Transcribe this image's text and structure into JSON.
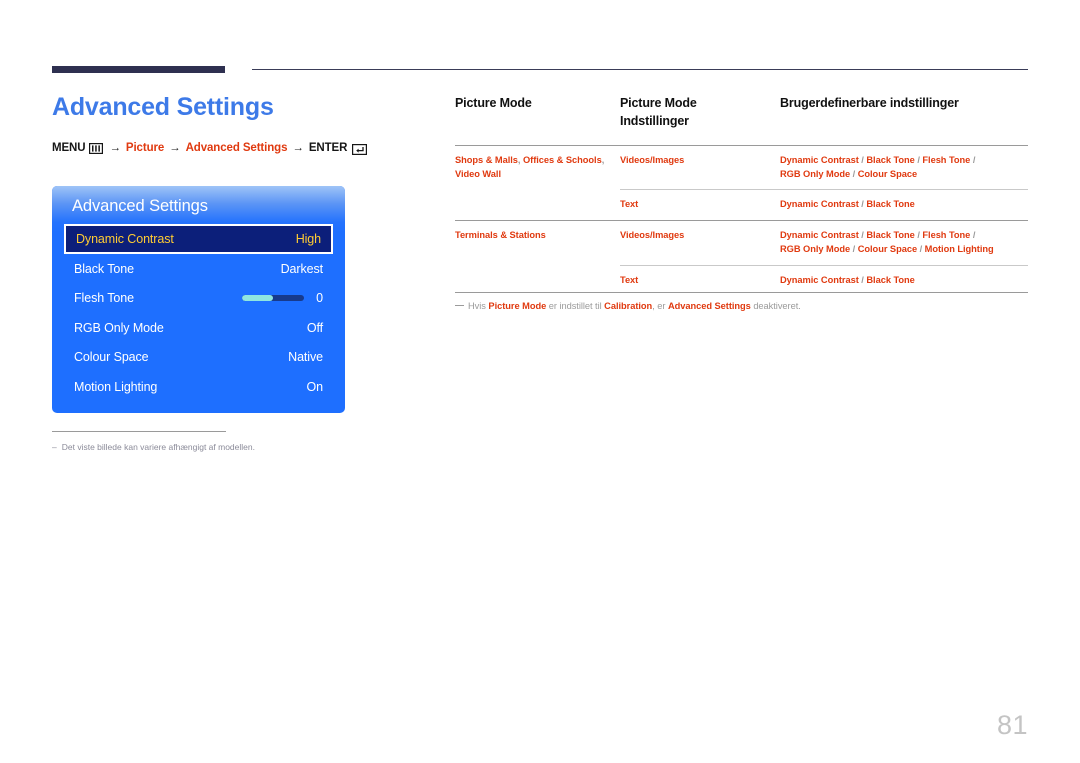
{
  "page": {
    "title": "Advanced Settings",
    "page_number": "81",
    "title_color": "#3d7ae8",
    "accent_red": "#e03a10",
    "rule_color": "#2e3050"
  },
  "menu_path": {
    "menu_label": "MENU",
    "menu_icon": "menu-bars-icon",
    "arrow": "→",
    "step1": "Picture",
    "step2": "Advanced Settings",
    "enter_label": "ENTER",
    "enter_icon": "enter-return-icon"
  },
  "osd": {
    "title": "Advanced Settings",
    "background": "#1e6fff",
    "selected_background": "#0c1f7a",
    "selected_text": "#ffcc33",
    "rows": [
      {
        "label": "Dynamic Contrast",
        "value": "High",
        "selected": true,
        "type": "value"
      },
      {
        "label": "Black Tone",
        "value": "Darkest",
        "selected": false,
        "type": "value"
      },
      {
        "label": "Flesh Tone",
        "value": "0",
        "selected": false,
        "type": "slider",
        "slider_percent": 50
      },
      {
        "label": "RGB Only Mode",
        "value": "Off",
        "selected": false,
        "type": "value"
      },
      {
        "label": "Colour Space",
        "value": "Native",
        "selected": false,
        "type": "value"
      },
      {
        "label": "Motion Lighting",
        "value": "On",
        "selected": false,
        "type": "value"
      }
    ]
  },
  "left_note": {
    "dash": "–",
    "text": "Det viste billede kan variere afhængigt af modellen."
  },
  "table": {
    "headers": {
      "col1": "Picture Mode",
      "col2_line1": "Picture Mode",
      "col2_line2": "Indstillinger",
      "col3": "Brugerdefinerbare indstillinger"
    },
    "groups": [
      {
        "mode_line1_a": "Shops & Malls",
        "mode_line1_comma1": ",",
        "mode_line1_b": "Offices & Schools",
        "mode_line1_comma2": ",",
        "mode_line2": "Video Wall",
        "rows": [
          {
            "setting": "Videos/Images",
            "options_line1": [
              "Dynamic Contrast",
              "Black Tone",
              "Flesh Tone"
            ],
            "options_line1_trailing_slash": true,
            "options_line2": [
              "RGB Only Mode",
              "Colour Space"
            ]
          },
          {
            "setting": "Text",
            "options_line1": [
              "Dynamic Contrast",
              "Black Tone"
            ],
            "options_line1_trailing_slash": false,
            "options_line2": []
          }
        ]
      },
      {
        "mode_line1_a": "Terminals & Stations",
        "mode_line1_comma1": "",
        "mode_line1_b": "",
        "mode_line1_comma2": "",
        "mode_line2": "",
        "rows": [
          {
            "setting": "Videos/Images",
            "options_line1": [
              "Dynamic Contrast",
              "Black Tone",
              "Flesh Tone"
            ],
            "options_line1_trailing_slash": true,
            "options_line2": [
              "RGB Only Mode",
              "Colour Space",
              "Motion Lighting"
            ]
          },
          {
            "setting": "Text",
            "options_line1": [
              "Dynamic Contrast",
              "Black Tone"
            ],
            "options_line1_trailing_slash": false,
            "options_line2": []
          }
        ]
      }
    ]
  },
  "right_note": {
    "prefix": "Hvis ",
    "term1": "Picture Mode",
    "mid1": " er indstillet til ",
    "term2": "Calibration",
    "mid2": ", er ",
    "term3": "Advanced Settings",
    "suffix": " deaktiveret."
  }
}
